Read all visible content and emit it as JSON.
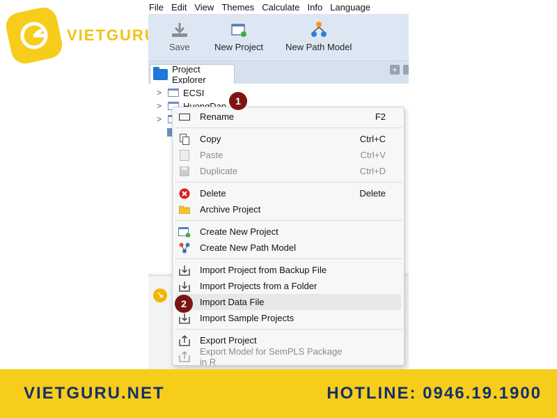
{
  "brand": {
    "logo_text": "VIETGURU",
    "footer_website": "VIETGURU.NET",
    "footer_hotline": "HOTLINE: 0946.19.1900",
    "colors": {
      "yellow": "#f7cd1b",
      "navy": "#13306b",
      "badge_red": "#7d1414"
    }
  },
  "menubar": {
    "items": [
      "File",
      "Edit",
      "View",
      "Themes",
      "Calculate",
      "Info",
      "Language"
    ]
  },
  "toolbar": {
    "save_label": "Save",
    "new_project_label": "New Project",
    "new_path_model_label": "New Path Model"
  },
  "explorer": {
    "tab_label": "Project Explorer",
    "tree_items": [
      "ECSI",
      "HuongDan"
    ]
  },
  "context_menu": {
    "items": [
      {
        "label": "Rename",
        "shortcut": "F2",
        "icon": "rename-icon",
        "enabled": true
      },
      {
        "label": "Copy",
        "shortcut": "Ctrl+C",
        "icon": "copy-icon",
        "enabled": true
      },
      {
        "label": "Paste",
        "shortcut": "Ctrl+V",
        "icon": "paste-icon",
        "enabled": false
      },
      {
        "label": "Duplicate",
        "shortcut": "Ctrl+D",
        "icon": "duplicate-icon",
        "enabled": false
      },
      {
        "label": "Delete",
        "shortcut": "Delete",
        "icon": "delete-icon",
        "enabled": true
      },
      {
        "label": "Archive Project",
        "shortcut": "",
        "icon": "folder-icon",
        "enabled": true
      },
      {
        "label": "Create New Project",
        "shortcut": "",
        "icon": "new-project-icon",
        "enabled": true
      },
      {
        "label": "Create New Path Model",
        "shortcut": "",
        "icon": "path-model-icon",
        "enabled": true
      },
      {
        "label": "Import Project from Backup File",
        "shortcut": "",
        "icon": "import-icon",
        "enabled": true
      },
      {
        "label": "Import Projects from a Folder",
        "shortcut": "",
        "icon": "import-icon",
        "enabled": true
      },
      {
        "label": "Import Data File",
        "shortcut": "",
        "icon": "import-icon",
        "enabled": true,
        "highlighted": true
      },
      {
        "label": "Import Sample Projects",
        "shortcut": "",
        "icon": "import-icon",
        "enabled": true
      },
      {
        "label": "Export Project",
        "shortcut": "",
        "icon": "export-icon",
        "enabled": true
      },
      {
        "label": "Export Model for SemPLS Package in R",
        "shortcut": "",
        "icon": "export-icon",
        "enabled": false
      }
    ]
  },
  "step_badges": [
    "1",
    "2"
  ]
}
